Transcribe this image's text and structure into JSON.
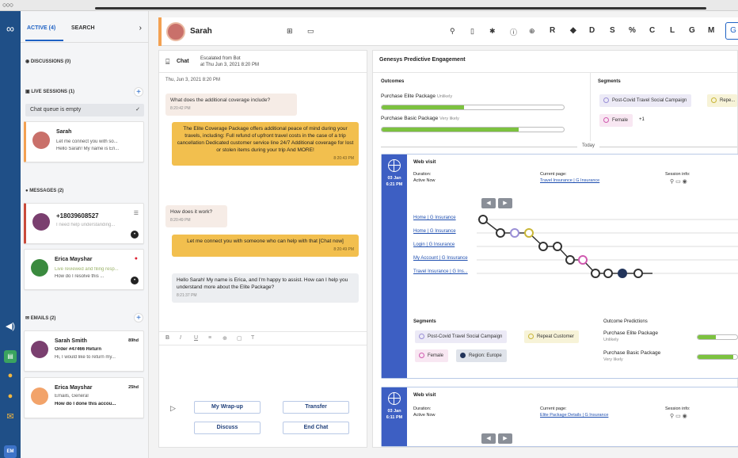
{
  "left": {
    "tabs": {
      "active": "ACTIVE (4)",
      "search": "SEARCH"
    },
    "discussions": "DISCUSSIONS (0)",
    "live_sessions": "LIVE SESSIONS (1)",
    "queue": "Chat queue is empty",
    "sessions": [
      {
        "name": "Sarah",
        "l1": "Let me connect you with so...",
        "l2": "Hello Sarah! My name is Eri..."
      }
    ],
    "messages_label": "MESSAGES (2)",
    "messages": [
      {
        "name": "+18039608527",
        "l1": "I need help understanding..."
      },
      {
        "name": "Erica Mayshar",
        "l1": "Live reviewed and filing resp...",
        "l2": "How do I resolve this ..."
      }
    ],
    "emails_label": "EMAILS (2)",
    "emails": [
      {
        "name": "Sarah Smith",
        "time": "89hd",
        "l1": "Order #47466 Return",
        "l2": "Hi, I would like to return my..."
      },
      {
        "name": "Erica Mayshar",
        "time": "25hd",
        "l1": "Emails, General",
        "l2": "How do I done this accou..."
      }
    ]
  },
  "rail": {
    "em": "EM"
  },
  "header": {
    "name": "Sarah",
    "letters": [
      "R",
      "D",
      "S",
      "C",
      "L",
      "G",
      "M"
    ]
  },
  "chat": {
    "title": "Chat",
    "escalated": "Escalated from Bot",
    "escalated_time": "at Thu Jun 3, 2021 8:20 PM",
    "date": "Thu, Jun 3, 2021 8:20 PM",
    "messages": [
      {
        "text": "What does the additional coverage include?",
        "ts": "8:20:42 PM"
      },
      {
        "text": "The Elite Coverage Package offers additional peace of mind during your travels, including: Full refund of upfront travel costs in the case of a trip cancellation Dedicated customer service line 24/7 Additional coverage for lost or stolen items during your trip And MORE!",
        "ts": "8:20:43 PM"
      },
      {
        "text": "How does it work?",
        "ts": "8:20:49 PM"
      },
      {
        "text": "Let me connect you with someone who can help with that [Chat now]",
        "ts": "8:20:49 PM"
      },
      {
        "text": "Hello Sarah! My name is Erica, and I'm happy to assist. How can I help you understand more about the Elite Package?",
        "ts": "8:21:37 PM"
      }
    ],
    "format_tools": [
      "B",
      "I",
      "U",
      "≡",
      "⊕",
      "▢",
      "T"
    ],
    "buttons": {
      "wrapup": "My Wrap-up",
      "transfer": "Transfer",
      "discuss": "Discuss",
      "end": "End Chat"
    }
  },
  "engagement": {
    "title": "Genesys Predictive Engagement",
    "outcomes_label": "Outcomes",
    "segments_label": "Segments",
    "outcomes": [
      {
        "name": "Purchase Elite Package",
        "likelihood": "Unlikely",
        "fill": 0.45
      },
      {
        "name": "Purchase Basic Package",
        "likelihood": "Very likely",
        "fill": 0.75
      }
    ],
    "segments": [
      "Post-Covid Travel Social Campaign",
      "Repe...",
      "Female",
      "+1"
    ],
    "today": "Today",
    "visits": [
      {
        "title": "Web visit",
        "date": "03 Jan",
        "time": "6:21 PM",
        "duration_label": "Duration:",
        "duration": "Active Now",
        "page_label": "Current page:",
        "page": "Travel Insurance | G Insurance",
        "session_label": "Session info:",
        "journey": [
          "Home | G Insurance",
          "Home | G Insurance",
          "Login | G Insurance",
          "My Account | G Insurance",
          "Travel Insurance | G Ins..."
        ],
        "segments_label": "Segments",
        "segments": [
          "Post-Covid Travel Social Campaign",
          "Repeat Customer",
          "Female",
          "Region: Europe"
        ],
        "pred_label": "Outcome Predictions",
        "predictions": [
          {
            "name": "Purchase Elite Package",
            "likelihood": "Unlikely",
            "fill": 0.45
          },
          {
            "name": "Purchase Basic Package",
            "likelihood": "Very likely",
            "fill": 0.9
          }
        ]
      },
      {
        "title": "Web visit",
        "date": "03 Jan",
        "time": "6:11 PM",
        "duration_label": "Duration:",
        "duration": "Active Now",
        "page_label": "Current page:",
        "page": "Elite Package Details | G Insurance",
        "session_label": "Session info:"
      }
    ]
  },
  "colors": {
    "rail": "#1f4f87",
    "accent": "#f3a152",
    "bubble_out": "#f2bf4e",
    "visit": "#3d5fc3",
    "progress": "#7cc23f"
  }
}
